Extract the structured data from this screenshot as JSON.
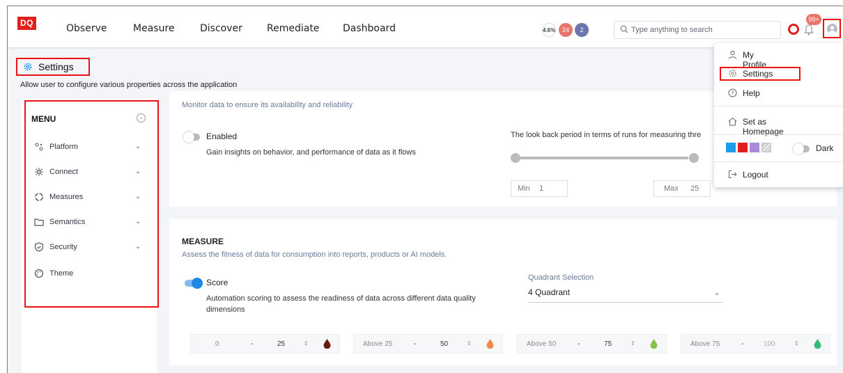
{
  "header": {
    "logo": "DQ",
    "nav": [
      "Observe",
      "Measure",
      "Discover",
      "Remediate",
      "Dashboard"
    ],
    "chip_percent": "4.6%",
    "chip_red": "24",
    "chip_blue": "2",
    "search_placeholder": "Type anything to search",
    "notification_count": "99+"
  },
  "page": {
    "title": "Settings",
    "subtitle": "Allow user to configure various properties across the application"
  },
  "sidebar": {
    "heading": "MENU",
    "items": [
      {
        "label": "Platform",
        "icon": "platform-icon"
      },
      {
        "label": "Connect",
        "icon": "connect-icon"
      },
      {
        "label": "Measures",
        "icon": "measures-icon"
      },
      {
        "label": "Semantics",
        "icon": "folder-icon"
      },
      {
        "label": "Security",
        "icon": "shield-icon"
      },
      {
        "label": "Theme",
        "icon": "palette-icon"
      }
    ]
  },
  "observe_panel": {
    "description": "Monitor data to ensure its availability and reliability",
    "toggle_label": "Enabled",
    "toggle_desc": "Gain insights on behavior, and performance of data as it flows",
    "lookback_label": "The look back period in terms of runs for measuring thre",
    "min_label": "Min",
    "min_value": "1",
    "max_label": "Max",
    "max_value": "25"
  },
  "measure_panel": {
    "heading": "MEASURE",
    "description": "Assess the fitness of data for consumption into reports, products or AI models.",
    "score_label": "Score",
    "score_desc_line1": "Automation scoring to assess the readiness of data across different data quality",
    "score_desc_line2": "dimensions",
    "quadrant_label": "Quadrant Selection",
    "quadrant_value": "4 Quadrant",
    "ranges": [
      {
        "low": "0",
        "dash": "-",
        "high": "25",
        "color": "#6b1a10"
      },
      {
        "low": "Above 25",
        "dash": "-",
        "high": "50",
        "color": "#f08a4b"
      },
      {
        "low": "Above 50",
        "dash": "-",
        "high": "75",
        "color": "#8bc34a"
      },
      {
        "low": "Above 75",
        "dash": "-",
        "high": "100",
        "color": "#2ebd7a"
      }
    ]
  },
  "user_menu": {
    "my_profile": "My Profile",
    "settings": "Settings",
    "help": "Help",
    "set_homepage": "Set as Homepage",
    "dark_label": "Dark",
    "logout": "Logout",
    "theme_colors": [
      "#1e9be9",
      "#e0211b",
      "#a98bd6"
    ]
  }
}
